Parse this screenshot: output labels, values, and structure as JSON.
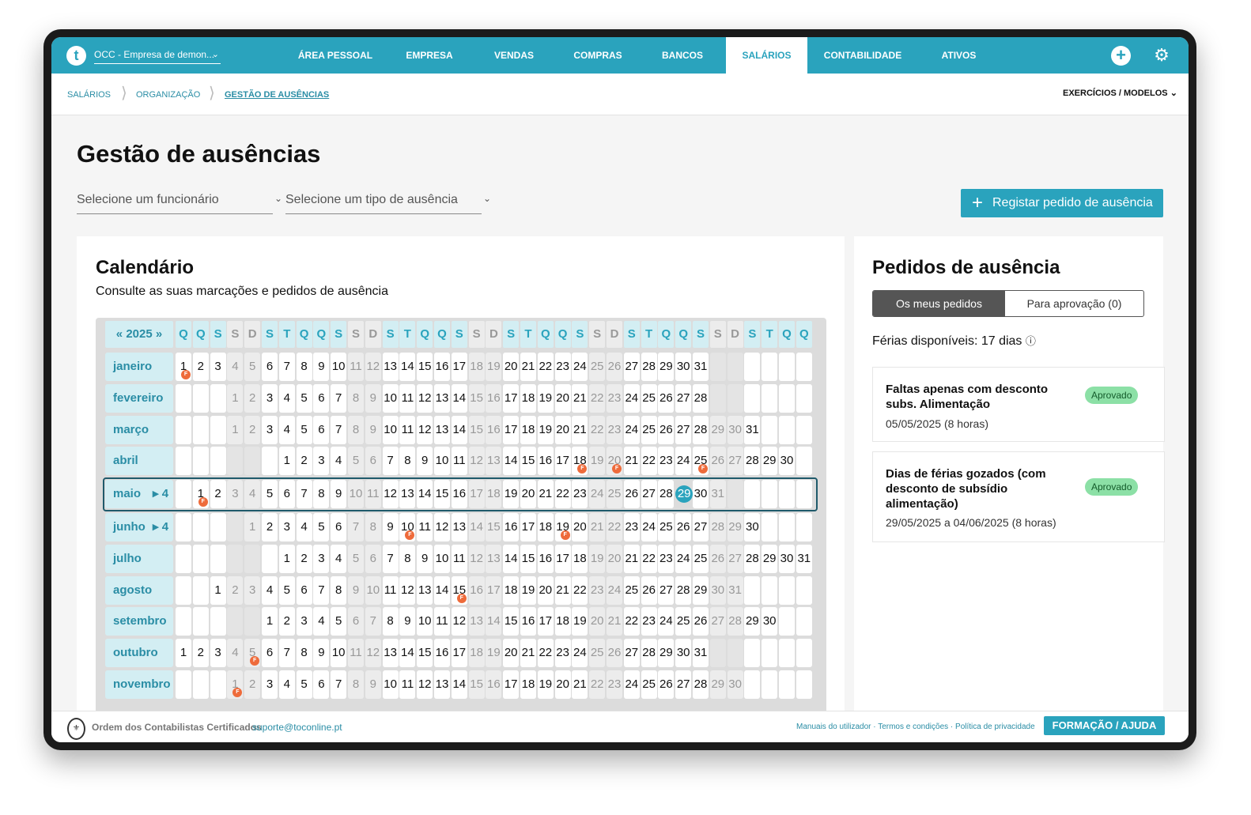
{
  "nav": {
    "logo": "t",
    "company": "OCC - Empresa de demon...",
    "tabs": [
      "ÁREA PESSOAL",
      "EMPRESA",
      "VENDAS",
      "COMPRAS",
      "BANCOS",
      "SALÁRIOS",
      "CONTABILIDADE",
      "ATIVOS"
    ],
    "active_tab": "SALÁRIOS"
  },
  "breadcrumb": [
    "SALÁRIOS",
    "ORGANIZAÇÃO",
    "GESTÃO DE AUSÊNCIAS"
  ],
  "exercicios_label": "EXERCÍCIOS / MODELOS",
  "page_title": "Gestão de ausências",
  "filters": {
    "employee_placeholder": "Selecione um funcionário",
    "absence_type_placeholder": "Selecione um tipo de ausência"
  },
  "register_button": "Registar pedido de ausência",
  "calendar": {
    "title": "Calendário",
    "subtitle": "Consulte as suas marcações e pedidos de ausência",
    "year": "2025",
    "weekday_header": [
      "Q",
      "Q",
      "S",
      "S",
      "D",
      "S",
      "T",
      "Q",
      "Q",
      "S",
      "S",
      "D",
      "S",
      "T",
      "Q",
      "Q",
      "S",
      "S",
      "D",
      "S",
      "T",
      "Q",
      "Q",
      "S",
      "S",
      "D",
      "S",
      "T",
      "Q",
      "Q",
      "S",
      "S",
      "D",
      "S",
      "T",
      "Q",
      "Q"
    ],
    "highlight_day": "29",
    "holiday_marker": "F",
    "months": [
      {
        "name": "janeiro",
        "offset": 0,
        "days": 31,
        "holidays": [
          1
        ]
      },
      {
        "name": "fevereiro",
        "offset": 3,
        "days": 28,
        "holidays": []
      },
      {
        "name": "março",
        "offset": 3,
        "days": 31,
        "holidays": []
      },
      {
        "name": "abril",
        "offset": 6,
        "days": 30,
        "holidays": [
          18,
          20,
          25
        ]
      },
      {
        "name": "maio",
        "offset": 1,
        "days": 31,
        "holidays": [
          1
        ],
        "count": "4",
        "selected": true
      },
      {
        "name": "junho",
        "offset": 4,
        "days": 30,
        "holidays": [
          10,
          19
        ],
        "count": "4"
      },
      {
        "name": "julho",
        "offset": 6,
        "days": 31,
        "holidays": []
      },
      {
        "name": "agosto",
        "offset": 2,
        "days": 31,
        "holidays": [
          15
        ]
      },
      {
        "name": "setembro",
        "offset": 5,
        "days": 30,
        "holidays": []
      },
      {
        "name": "outubro",
        "offset": 0,
        "days": 31,
        "holidays": [
          5
        ]
      },
      {
        "name": "novembro",
        "offset": 3,
        "days": 30,
        "holidays": [
          1
        ]
      }
    ]
  },
  "pedidos": {
    "title": "Pedidos de ausência",
    "tab_mine": "Os meus pedidos",
    "tab_approval": "Para aprovação (0)",
    "ferias": "Férias disponíveis: 17 dias",
    "requests": [
      {
        "title": "Faltas apenas com desconto subs. Alimentação",
        "date": "05/05/2025 (8 horas)",
        "status": "Aprovado"
      },
      {
        "title": "Dias de férias gozados (com desconto de subsídio alimentação)",
        "date": "29/05/2025 a 04/06/2025 (8 horas)",
        "status": "Aprovado"
      }
    ]
  },
  "footer": {
    "org": "Ordem dos Contabilistas Certificados",
    "email": "suporte@toconline.pt",
    "links": "Manuais do utilizador · Termos e condições · Política de privacidade",
    "help_button": "FORMAÇÃO / AJUDA"
  },
  "colors": {
    "accent": "#2aa3bd",
    "holiday": "#ee6b3b",
    "approved": "#8ce0a6"
  }
}
